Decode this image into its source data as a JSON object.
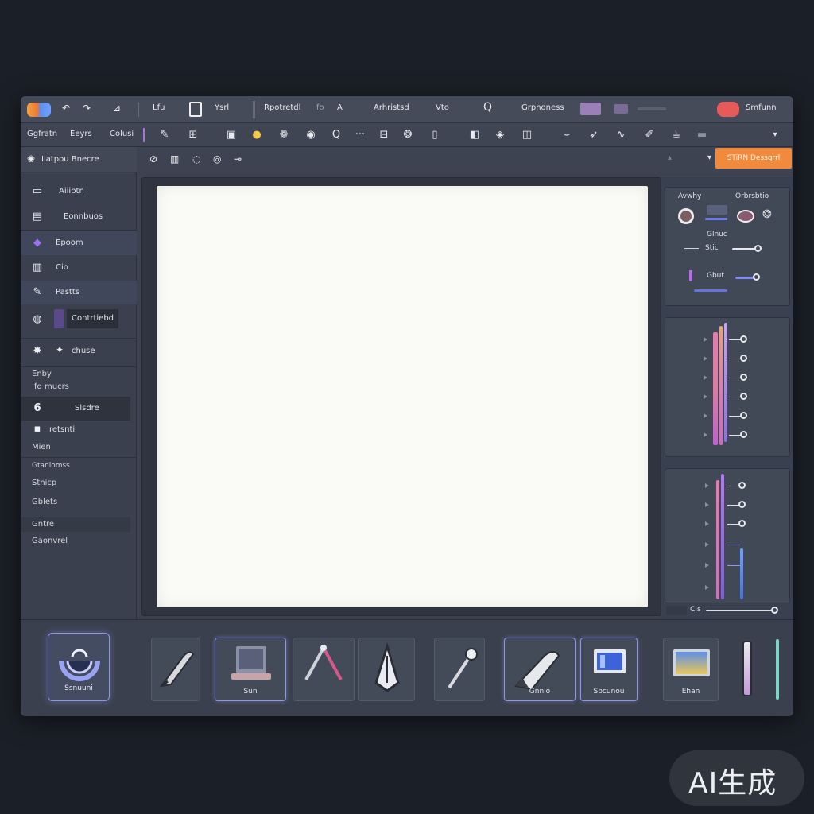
{
  "menubar": {
    "items": [
      "Lfu",
      "Ysrl",
      "Rpotretdl",
      "fo",
      "A",
      "Arhristsd",
      "Vto",
      "Q",
      "Grpnoness",
      "Smfunn"
    ]
  },
  "toolbar": {
    "labels": [
      "Ggfratn",
      "Eeyrs",
      "Colusi"
    ],
    "glyphs": [
      "✎",
      "⊞",
      "▣",
      "●",
      "❁",
      "◉",
      "Q",
      "···",
      "⊟",
      "❂",
      "▯",
      "◧",
      "◈",
      "◫",
      "⌣",
      "➶",
      "∿",
      "✐",
      "☕",
      "▬",
      "▾"
    ]
  },
  "leftpanel": {
    "header": "Iiatpou Bnecre",
    "items": [
      {
        "icon": "▭",
        "label": "Aiiiptn"
      },
      {
        "icon": "▤",
        "label": "Eonnbuos"
      },
      {
        "icon": "◆",
        "label": "Epoom"
      },
      {
        "icon": "▥",
        "label": "Cio"
      },
      {
        "icon": "✎",
        "label": "Pastts"
      },
      {
        "icon": "◍",
        "label": "Contrtiebd"
      },
      {
        "icon": "✦",
        "label": "chuse"
      }
    ],
    "group1": [
      "Enby",
      "Ifd mucrs"
    ],
    "item8": {
      "icon": "6",
      "label": "Slsdre"
    },
    "item9": {
      "icon": "▪",
      "label": "retsnti"
    },
    "group2": [
      "Mien"
    ],
    "group3": [
      "Gtaniomss",
      "Stnicp",
      "Gblets"
    ],
    "group4": [
      "Gntre",
      "Gaonvrel"
    ]
  },
  "docbar": {
    "glyphs": [
      "⊘",
      "▥",
      "◌",
      "◎",
      "⊸"
    ],
    "action_label": "STiRN Dessgrrl"
  },
  "rightpanel": {
    "section1": {
      "labels": [
        "Avwhy",
        "Orbrsbtio",
        "Glnuc",
        "Stic",
        "Gbut"
      ]
    },
    "footer_label": "CIs"
  },
  "bottombar": {
    "brand_caption": "Ssnuuni",
    "tools": [
      {
        "name": "pen-tool",
        "caption": ""
      },
      {
        "name": "tablet-tool",
        "caption": "Sun"
      },
      {
        "name": "compass-tool",
        "caption": ""
      },
      {
        "name": "nib-tool",
        "caption": ""
      },
      {
        "name": "brush-tool",
        "caption": ""
      },
      {
        "name": "marker-tool",
        "caption": "Gnnio"
      },
      {
        "name": "monitor-tool",
        "caption": "Sbcunou"
      },
      {
        "name": "display-tool",
        "caption": "Ehan"
      },
      {
        "name": "stylus-tool",
        "caption": ""
      }
    ]
  },
  "watermark": "AI生成",
  "colors": {
    "accent_orange": "#f08a3c",
    "accent_purple": "#8c95e8",
    "accent_pink": "#e069b5",
    "accent_blue": "#5a7ee6"
  }
}
